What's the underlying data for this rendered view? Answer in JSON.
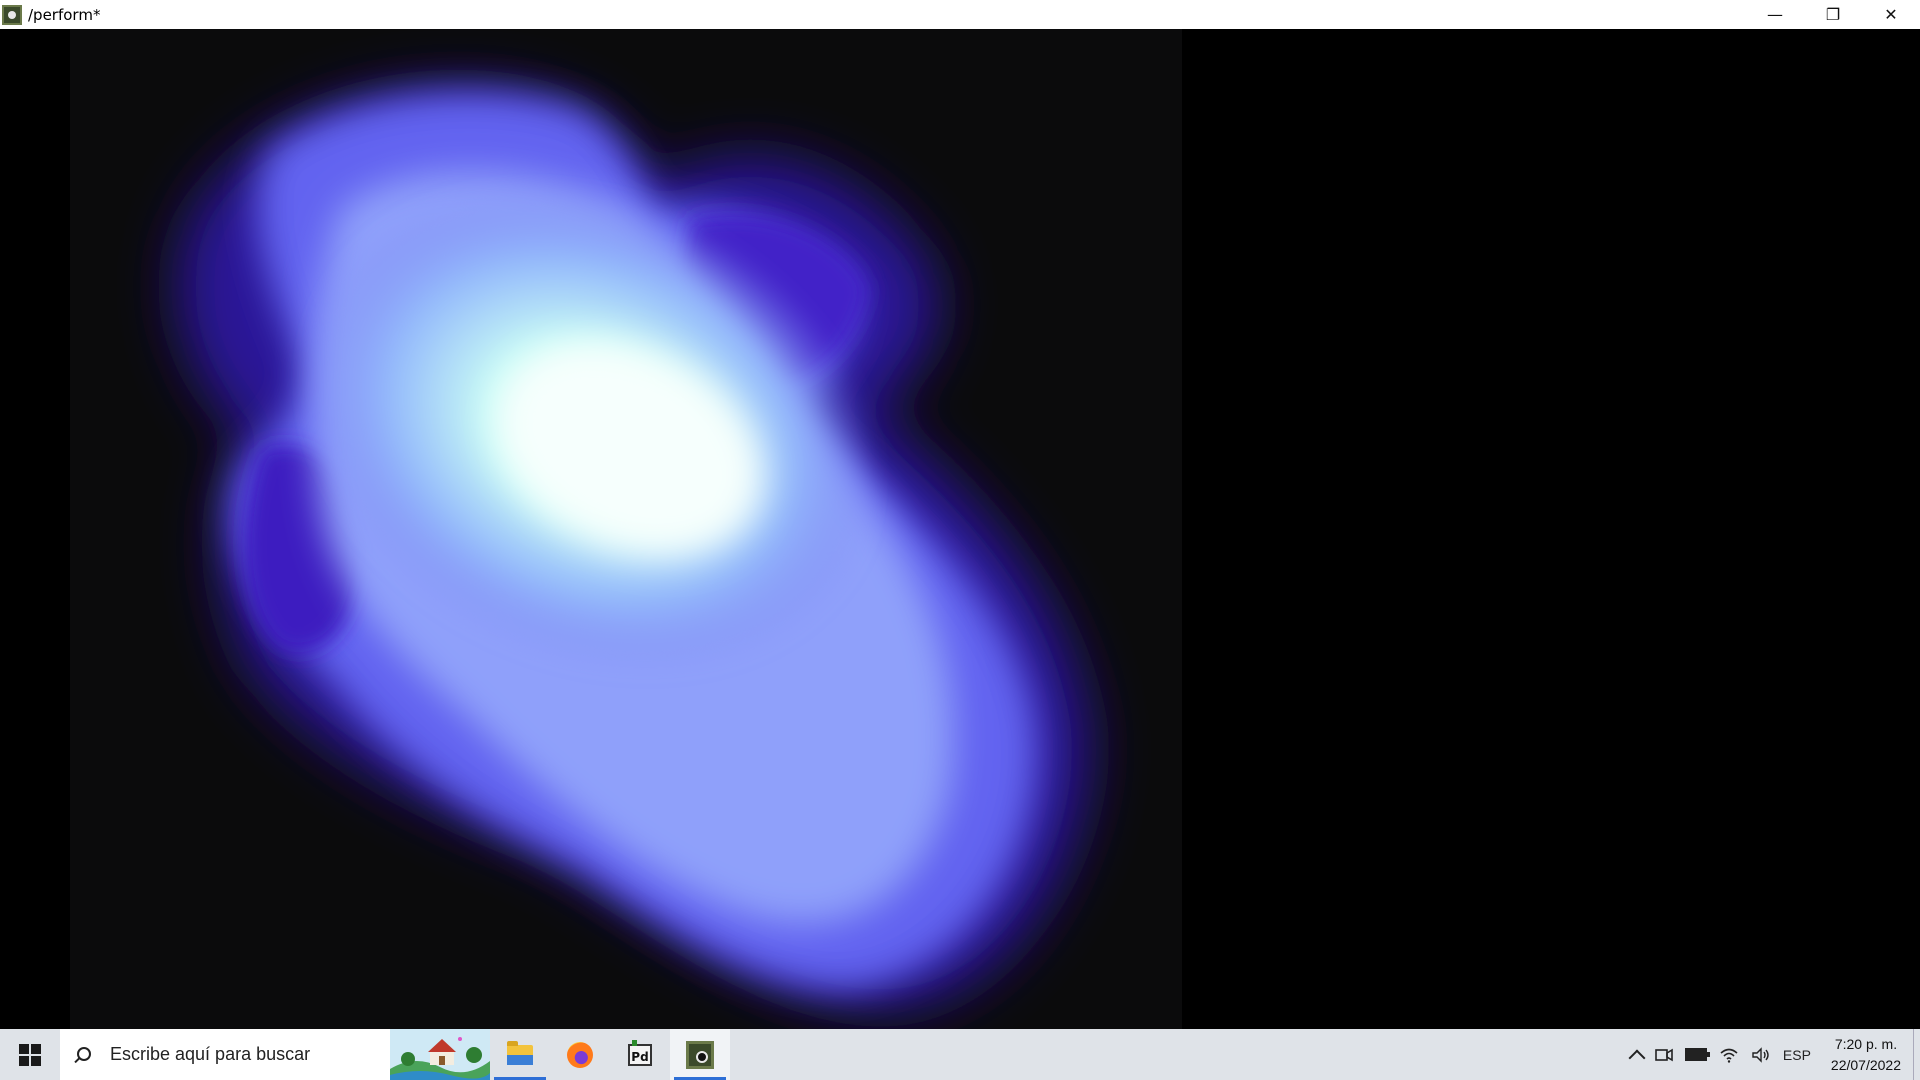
{
  "window": {
    "title": "/perform*",
    "controls": {
      "minimize": "—",
      "maximize": "❐",
      "close": "✕"
    }
  },
  "canvas": {
    "background": "#0b0b0c",
    "blob_colors": {
      "outer": "#3a1fb0",
      "mid": "#6d70f5",
      "core": "#e8fffb"
    }
  },
  "taskbar": {
    "search_placeholder": "Escribe aquí para buscar",
    "apps": [
      {
        "name": "file-explorer",
        "icon": "folder-icon"
      },
      {
        "name": "firefox",
        "icon": "firefox-icon"
      },
      {
        "name": "pure-data",
        "icon": "pd-icon",
        "label": "Pd"
      },
      {
        "name": "gem-window",
        "icon": "gem-icon"
      }
    ],
    "tray": {
      "language": "ESP",
      "time": "7:20 p. m.",
      "date": "22/07/2022"
    }
  }
}
